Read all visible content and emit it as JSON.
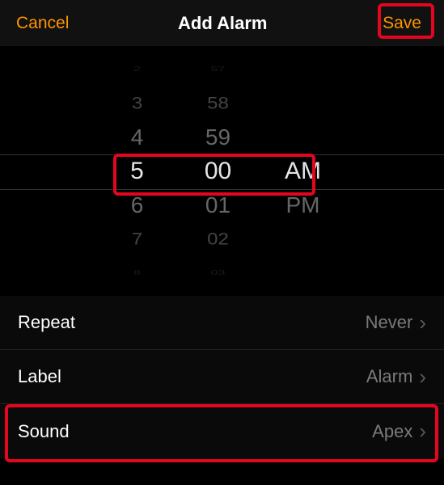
{
  "header": {
    "cancel": "Cancel",
    "title": "Add Alarm",
    "save": "Save"
  },
  "picker": {
    "hours": [
      "2",
      "3",
      "4",
      "5",
      "6",
      "7",
      "8"
    ],
    "minutes": [
      "57",
      "58",
      "59",
      "00",
      "01",
      "02",
      "03"
    ],
    "ampm": [
      "AM",
      "PM"
    ],
    "selected": {
      "hour": "5",
      "minute": "00",
      "ampm": "AM"
    }
  },
  "rows": {
    "repeat": {
      "label": "Repeat",
      "value": "Never"
    },
    "label": {
      "label": "Label",
      "value": "Alarm"
    },
    "sound": {
      "label": "Sound",
      "value": "Apex"
    }
  },
  "colors": {
    "accent": "#ff9500",
    "highlight": "#e4061f"
  }
}
